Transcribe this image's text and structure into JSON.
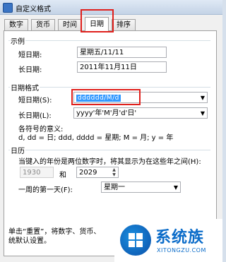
{
  "window": {
    "title": "自定义格式"
  },
  "tabs": [
    {
      "label": "数字"
    },
    {
      "label": "货币"
    },
    {
      "label": "时间"
    },
    {
      "label": "日期"
    },
    {
      "label": "排序"
    }
  ],
  "examples": {
    "group_title": "示例",
    "short_label": "短日期:",
    "short_value": "星期五/11/11",
    "long_label": "长日期:",
    "long_value": "2011年11月11日"
  },
  "formats": {
    "group_title": "日期格式",
    "short_label": "短日期(S):",
    "short_value": "dddddd/M/d",
    "long_label": "长日期(L):",
    "long_value": "yyyy'年'M'月'd'日'",
    "symbols_title": "各符号的意义:",
    "symbols_text": "d, dd = 日;  ddd, dddd = 星期;  M = 月;  y = 年"
  },
  "calendar": {
    "group_title": "日历",
    "description": "当键入的年份是两位数字时，将其显示为在这些年之间(H):",
    "year_from": "1930",
    "and_label": "和",
    "year_to": "2029",
    "first_day_label": "一周的第一天(F):",
    "first_day_value": "星期一"
  },
  "footer": {
    "line1": "单击“重置”，将数字、货币、",
    "line2": "统默认设置。"
  },
  "watermark": {
    "brand": "系统族",
    "url": "XITONGZU.COM"
  },
  "colors": {
    "highlight": "#e0201c",
    "selection": "#3399ff",
    "brand": "#0b6cc9"
  }
}
